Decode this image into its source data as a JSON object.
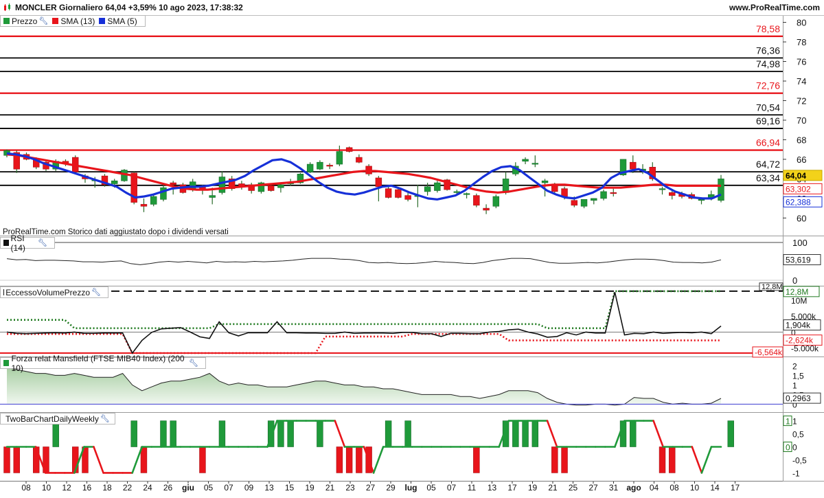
{
  "header": {
    "title": "MONCLER Giornaliero 64,04 +3,59% 10 ago 2023, 17:38:32",
    "site": "www.ProRealTime.com"
  },
  "note": "ProRealTime.com Storico dati aggiustato dopo i dividendi versati",
  "legends": {
    "price": [
      {
        "label": "Prezzo",
        "color": "#1f9a3a"
      },
      {
        "label": "SMA (13)",
        "color": "#e8151b"
      },
      {
        "label": "SMA (5)",
        "color": "#1630d8"
      }
    ],
    "rsi": "RSI (14)",
    "volume": "EccessoVolumePrezzo",
    "mansfield": "Forza relat Mansfield (FTSE MIB40 Index) (200 10)",
    "twobar": "TwoBarChartDailyWeekly"
  },
  "colors": {
    "up": "#1f9a3a",
    "down": "#e8151b",
    "sma13": "#e8151b",
    "sma5": "#1630d8",
    "resistance": "#e8151b",
    "support": "#000000",
    "dotted_green": "#1f7a1f",
    "dotted_red": "#e8151b",
    "mansfield_fill": "#d5e8d2"
  },
  "chart_data": [
    {
      "type": "candlestick",
      "panel": "price",
      "ylim": [
        58.2,
        80.6
      ],
      "y_ticks": [
        60,
        62,
        64,
        66,
        68,
        70,
        72,
        74,
        76,
        78,
        80
      ],
      "levels": [
        {
          "value": 78.58,
          "label": "78,58",
          "color": "red"
        },
        {
          "value": 76.36,
          "label": "76,36",
          "color": "black"
        },
        {
          "value": 74.98,
          "label": "74,98",
          "color": "black"
        },
        {
          "value": 72.76,
          "label": "72,76",
          "color": "red"
        },
        {
          "value": 70.54,
          "label": "70,54",
          "color": "black"
        },
        {
          "value": 69.16,
          "label": "69,16",
          "color": "black"
        },
        {
          "value": 66.94,
          "label": "66,94",
          "color": "red"
        },
        {
          "value": 64.72,
          "label": "64,72",
          "color": "black"
        },
        {
          "value": 63.34,
          "label": "63,34",
          "color": "black"
        }
      ],
      "value_tags": [
        {
          "label": "64,04",
          "value": 64.04,
          "style": "price"
        },
        {
          "label": "63,302",
          "value": 63.302,
          "style": "sma13"
        },
        {
          "label": "62,388",
          "value": 62.388,
          "style": "sma5"
        }
      ],
      "x_labels": [
        "08",
        "10",
        "12",
        "16",
        "18",
        "22",
        "24",
        "26",
        "giu",
        "05",
        "07",
        "09",
        "13",
        "15",
        "19",
        "21",
        "23",
        "27",
        "29",
        "lug",
        "05",
        "07",
        "11",
        "13",
        "17",
        "19",
        "21",
        "25",
        "27",
        "31",
        "ago",
        "04",
        "08",
        "10",
        "14",
        "17"
      ],
      "ohlc": [
        [
          66.4,
          67.0,
          66.2,
          66.9
        ],
        [
          66.7,
          66.9,
          64.6,
          65.0
        ],
        [
          66.5,
          66.7,
          65.9,
          66.0
        ],
        [
          66.0,
          66.2,
          65.0,
          65.2
        ],
        [
          65.7,
          65.9,
          64.8,
          65.0
        ],
        [
          65.0,
          66.0,
          64.8,
          65.8
        ],
        [
          65.8,
          66.0,
          65.3,
          65.6
        ],
        [
          66.2,
          66.4,
          64.6,
          64.7
        ],
        [
          64.3,
          64.5,
          63.6,
          64.0
        ],
        [
          63.8,
          64.2,
          63.1,
          63.9
        ],
        [
          64.3,
          64.5,
          63.2,
          63.4
        ],
        [
          63.5,
          64.0,
          63.1,
          63.8
        ],
        [
          63.8,
          65.0,
          63.7,
          64.9
        ],
        [
          64.6,
          64.8,
          61.4,
          61.6
        ],
        [
          61.4,
          62.0,
          60.6,
          61.2
        ],
        [
          61.4,
          62.4,
          61.2,
          62.2
        ],
        [
          61.9,
          63.4,
          61.7,
          63.1
        ],
        [
          63.6,
          63.8,
          62.4,
          63.4
        ],
        [
          63.4,
          63.6,
          62.5,
          62.6
        ],
        [
          62.9,
          64.0,
          62.7,
          63.7
        ],
        [
          63.2,
          63.4,
          62.4,
          62.9
        ],
        [
          62.1,
          63.1,
          61.4,
          62.3
        ],
        [
          62.6,
          64.8,
          62.4,
          64.2
        ],
        [
          64.0,
          64.3,
          62.8,
          63.0
        ],
        [
          63.5,
          63.8,
          62.9,
          63.2
        ],
        [
          63.4,
          63.6,
          62.5,
          62.8
        ],
        [
          62.7,
          63.7,
          62.5,
          63.6
        ],
        [
          63.3,
          63.5,
          62.7,
          62.8
        ],
        [
          63.1,
          63.5,
          62.6,
          63.4
        ],
        [
          63.5,
          64.0,
          63.3,
          63.6
        ],
        [
          63.6,
          64.6,
          63.5,
          64.5
        ],
        [
          64.7,
          65.7,
          64.6,
          65.5
        ],
        [
          65.0,
          65.9,
          64.9,
          65.7
        ],
        [
          65.4,
          65.6,
          65.0,
          65.3
        ],
        [
          65.5,
          67.4,
          65.3,
          66.8
        ],
        [
          67.2,
          67.3,
          66.7,
          66.8
        ],
        [
          66.2,
          66.5,
          65.6,
          65.7
        ],
        [
          65.3,
          65.5,
          64.3,
          64.5
        ],
        [
          64.1,
          64.3,
          61.7,
          63.2
        ],
        [
          63.0,
          63.2,
          62.0,
          62.1
        ],
        [
          62.9,
          63.0,
          62.0,
          62.1
        ],
        [
          62.3,
          62.6,
          61.7,
          61.9
        ],
        [
          62.2,
          63.4,
          61.1,
          62.3
        ],
        [
          62.7,
          63.6,
          62.3,
          63.2
        ],
        [
          62.8,
          63.8,
          62.6,
          63.6
        ],
        [
          63.9,
          64.0,
          62.8,
          62.9
        ],
        [
          62.6,
          62.9,
          62.3,
          62.7
        ],
        [
          62.4,
          62.6,
          62.0,
          62.5
        ],
        [
          62.3,
          62.5,
          61.1,
          61.3
        ],
        [
          61.0,
          61.4,
          60.4,
          60.8
        ],
        [
          61.2,
          62.4,
          61.0,
          62.2
        ],
        [
          62.6,
          64.7,
          62.4,
          64.0
        ],
        [
          64.5,
          65.7,
          64.3,
          65.3
        ],
        [
          65.8,
          66.2,
          65.5,
          66.0
        ],
        [
          65.6,
          66.4,
          65.2,
          65.6
        ],
        [
          63.6,
          64.0,
          62.2,
          63.8
        ],
        [
          63.4,
          63.6,
          62.5,
          62.7
        ],
        [
          63.0,
          63.2,
          61.9,
          62.2
        ],
        [
          61.8,
          62.2,
          61.1,
          61.3
        ],
        [
          61.2,
          61.9,
          61.0,
          61.9
        ],
        [
          61.8,
          62.0,
          61.4,
          62.0
        ],
        [
          62.0,
          62.9,
          61.8,
          62.7
        ],
        [
          62.6,
          63.0,
          62.2,
          62.5
        ],
        [
          64.4,
          66.0,
          64.3,
          66.0
        ],
        [
          65.7,
          66.4,
          64.6,
          65.0
        ],
        [
          64.8,
          65.5,
          64.5,
          65.0
        ],
        [
          65.2,
          65.7,
          63.8,
          64.0
        ],
        [
          62.9,
          63.2,
          62.4,
          63.0
        ],
        [
          62.6,
          62.8,
          61.9,
          62.3
        ],
        [
          62.5,
          62.7,
          62.0,
          62.2
        ],
        [
          62.4,
          62.6,
          61.9,
          62.0
        ],
        [
          61.8,
          62.1,
          61.4,
          61.9
        ],
        [
          62.0,
          62.8,
          61.8,
          62.4
        ],
        [
          61.8,
          64.4,
          61.6,
          64.0
        ]
      ],
      "sma13": [
        66.5,
        66.4,
        66.2,
        66.0,
        65.8,
        65.6,
        65.4,
        65.2,
        65.0,
        64.8,
        64.6,
        64.4,
        64.1,
        63.8,
        63.5,
        63.2,
        63.0,
        62.9,
        62.9,
        63.0,
        63.1,
        63.2,
        63.3,
        63.4,
        63.5,
        63.6,
        63.7,
        63.9,
        64.1,
        64.3,
        64.5,
        64.7,
        64.8,
        64.8,
        64.7,
        64.6,
        64.5,
        64.3,
        64.1,
        63.8,
        63.5,
        63.2,
        62.9,
        62.7,
        62.6,
        62.7,
        62.9,
        63.1,
        63.3,
        63.4,
        63.4,
        63.3,
        63.2,
        63.1,
        63.1,
        63.1,
        63.2,
        63.3,
        63.4,
        63.4,
        63.3,
        63.3,
        63.3,
        63.3,
        63.3
      ],
      "sma5": [
        66.6,
        66.5,
        66.3,
        66.0,
        65.6,
        65.3,
        65.0,
        64.7,
        64.4,
        64.1,
        63.8,
        63.5,
        63.2,
        62.6,
        62.1,
        62.2,
        62.4,
        62.7,
        63.0,
        63.1,
        63.2,
        63.2,
        63.3,
        63.5,
        63.7,
        63.9,
        64.3,
        64.9,
        65.4,
        65.9,
        66.0,
        65.7,
        65.1,
        64.4,
        63.7,
        63.1,
        62.7,
        62.5,
        62.4,
        62.6,
        62.9,
        63.2,
        63.3,
        63.0,
        62.6,
        62.3,
        62.0,
        61.9,
        62.1,
        62.3,
        62.8,
        63.5,
        64.2,
        64.8,
        65.2,
        65.3,
        64.9,
        64.2,
        63.5,
        62.8,
        62.4,
        62.1,
        62.0,
        62.3,
        62.6,
        63.1,
        64.1,
        64.6,
        64.8,
        65.0,
        64.6,
        63.9,
        63.2,
        62.7,
        62.4,
        62.1,
        62.0,
        62.0,
        62.4
      ]
    },
    {
      "type": "line",
      "panel": "rsi",
      "ylim": [
        0,
        100
      ],
      "y_ticks": [
        0,
        100
      ],
      "value_tag": "53,619",
      "values": [
        57,
        54,
        55,
        52,
        53,
        53,
        52,
        51,
        49,
        49,
        48,
        50,
        51,
        44,
        41,
        44,
        48,
        50,
        48,
        50,
        48,
        46,
        50,
        48,
        49,
        48,
        50,
        49,
        50,
        51,
        53,
        56,
        58,
        58,
        58,
        56,
        55,
        52,
        47,
        46,
        47,
        45,
        44,
        45,
        47,
        50,
        48,
        47,
        45,
        44,
        47,
        52,
        55,
        58,
        58,
        57,
        52,
        47,
        45,
        45,
        46,
        47,
        46,
        48,
        51,
        54,
        56,
        56,
        55,
        52,
        48,
        47,
        47,
        46,
        48,
        54
      ]
    },
    {
      "type": "line",
      "panel": "volume",
      "y_ticks": [
        "12,8M",
        "10M",
        "5.000k",
        "0",
        "-5.000k"
      ],
      "value_tags": [
        "12,8M",
        "1,904k",
        "-2,624k",
        "-6,564k"
      ],
      "levels": [
        12.8,
        -6.564
      ],
      "values_k": [
        0,
        -400,
        -500,
        -400,
        -300,
        -200,
        -300,
        0,
        -400,
        -400,
        -300,
        -300,
        -300,
        -6600,
        -2600,
        -100,
        1000,
        1200,
        1400,
        0,
        -1500,
        -2000,
        3200,
        -200,
        -1200,
        -200,
        -200,
        -200,
        3200,
        -200,
        -200,
        -300,
        -300,
        -400,
        -400,
        0,
        -400,
        -300,
        -300,
        -300,
        -400,
        -100,
        -100,
        -500,
        -500,
        -1400,
        -400,
        -400,
        -500,
        -500,
        0,
        200,
        700,
        900,
        0,
        -600,
        -1600,
        -1400,
        -200,
        -900,
        0,
        -300,
        -300,
        12500,
        -900,
        -400,
        -500,
        0,
        -400,
        -200,
        -100,
        -200,
        0,
        -500,
        1904
      ],
      "dotted_green_k": [
        3800,
        3800,
        3800,
        3800,
        3800,
        3800,
        3800,
        1200,
        1200,
        1200,
        1200,
        1200,
        1200,
        1200,
        1200,
        1200,
        1200,
        1200,
        1200,
        1200,
        1200,
        1200,
        2500,
        2500,
        2500,
        2500,
        2500,
        2500,
        2500,
        2500,
        2500,
        2500,
        2500,
        2500,
        2500,
        2500,
        2500,
        2500,
        2500,
        2500,
        2500,
        2500,
        2500,
        2500,
        2500,
        2500,
        2500,
        2500,
        2500,
        2500,
        2500,
        2500,
        2500,
        2500,
        2500,
        2500,
        1200,
        1200,
        1200,
        1200,
        1200,
        1200,
        1200,
        12800,
        12800,
        12800,
        12800,
        12800,
        12800,
        12800,
        12800,
        12800,
        12800,
        12800,
        12800
      ],
      "dotted_red_k": [
        -600,
        -600,
        -600,
        -600,
        -600,
        -600,
        -600,
        -600,
        -600,
        -600,
        -600,
        -600,
        -600,
        -6564,
        -6564,
        -6564,
        -6564,
        -6564,
        -6564,
        -6564,
        -6564,
        -6564,
        -6564,
        -6564,
        -6564,
        -6564,
        -6564,
        -6564,
        -6564,
        -6564,
        -6564,
        -6564,
        -6564,
        -1400,
        -1400,
        -1400,
        -1400,
        -1400,
        -1400,
        -1400,
        -1400,
        -1400,
        -600,
        -600,
        -600,
        -600,
        -600,
        -600,
        -600,
        -600,
        -600,
        -600,
        -2624,
        -2624,
        -2624,
        -2624,
        -2624,
        -2624,
        -2624,
        -2624,
        -2624,
        -2624,
        -2624,
        -2624,
        -2624,
        -2624,
        -2624,
        -2624,
        -2624,
        -2624,
        -2624,
        -2624,
        -2624,
        -2624,
        -2624
      ]
    },
    {
      "type": "area",
      "panel": "mansfield",
      "ylim": [
        -0.2,
        2.3
      ],
      "y_ticks": [
        0,
        0.5,
        1,
        1.5,
        2
      ],
      "y_tick_labels": [
        "0",
        "0,5",
        "1",
        "1,5",
        "2"
      ],
      "value_tag": "0,2963",
      "values": [
        1.9,
        1.8,
        1.7,
        1.6,
        1.6,
        1.5,
        1.5,
        1.6,
        1.5,
        1.4,
        1.4,
        1.4,
        1.6,
        1.0,
        0.7,
        0.9,
        1.1,
        1.2,
        1.2,
        1.3,
        1.4,
        1.6,
        1.2,
        1.0,
        1.1,
        1.0,
        1.0,
        0.9,
        0.9,
        0.9,
        1.0,
        1.1,
        1.2,
        1.2,
        1.1,
        1.0,
        1.0,
        0.9,
        0.9,
        0.8,
        0.8,
        0.7,
        0.6,
        0.5,
        0.5,
        0.5,
        0.5,
        0.4,
        0.4,
        0.3,
        0.4,
        0.5,
        0.7,
        0.7,
        0.7,
        0.6,
        0.3,
        0.1,
        0.0,
        -0.05,
        -0.05,
        0.0,
        0.0,
        -0.05,
        0.0,
        0.35,
        0.3,
        0.3,
        0.1,
        0.0,
        0.05,
        0.0,
        0.0,
        0.05,
        0.3
      ]
    },
    {
      "type": "bar",
      "panel": "twobar",
      "ylim": [
        -1.2,
        1.2
      ],
      "y_ticks": [
        1,
        0.5,
        0,
        -0.5,
        -1
      ],
      "y_tick_labels": [
        "1",
        "0,5",
        "0",
        "-0,5",
        "-1"
      ],
      "value_tags": [
        "1",
        "0"
      ],
      "bars": [
        -1,
        -1,
        0,
        -1,
        -1,
        1,
        0,
        -1,
        -1,
        0,
        0,
        0,
        0,
        1,
        -1,
        0,
        1,
        1,
        0,
        0,
        -1,
        0,
        1,
        0,
        0,
        0,
        0,
        1,
        1,
        1,
        0,
        0,
        1,
        0,
        -1,
        -1,
        -1,
        -1,
        0,
        1,
        0,
        1,
        0,
        0,
        0,
        0,
        0,
        0,
        -1,
        0,
        0,
        1,
        1,
        1,
        1,
        0,
        -1,
        -1,
        0,
        0,
        0,
        0,
        0,
        1,
        1,
        0,
        0,
        -1,
        -1,
        0,
        0,
        0,
        0,
        0,
        1
      ],
      "line": [
        0,
        0,
        0,
        0,
        -1,
        -1,
        -1,
        -1,
        0,
        0,
        -1,
        -1,
        -1,
        -1,
        0,
        0,
        0,
        0,
        0,
        0,
        0,
        0,
        0,
        0,
        0,
        0,
        0,
        0,
        1,
        1,
        1,
        1,
        1,
        1,
        1,
        0,
        0,
        0,
        -1,
        0,
        0,
        0,
        0,
        0,
        0,
        0,
        0,
        0,
        0,
        0,
        0,
        0,
        1,
        1,
        1,
        1,
        1,
        0,
        0,
        0,
        0,
        0,
        0,
        0,
        1,
        1,
        1,
        1,
        0,
        0,
        0,
        0,
        -1,
        0,
        0
      ]
    }
  ]
}
